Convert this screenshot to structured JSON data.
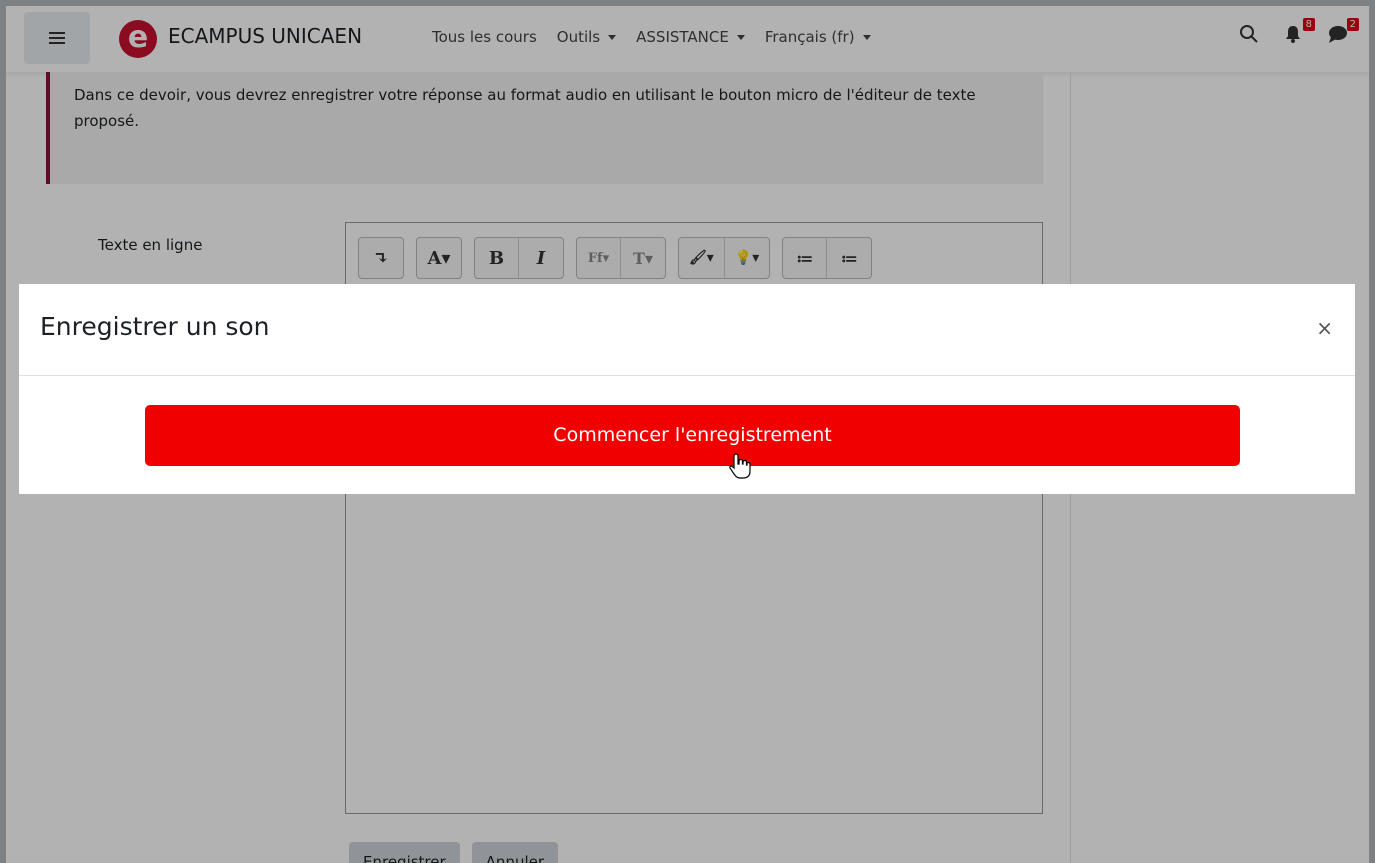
{
  "navbar": {
    "site_name": "ECAMPUS UNICAEN",
    "logo_letter": "e",
    "menu": [
      {
        "label": "Tous les cours",
        "has_caret": false
      },
      {
        "label": "Outils",
        "has_caret": true
      },
      {
        "label": "ASSISTANCE",
        "has_caret": true
      },
      {
        "label": "Français (fr)",
        "has_caret": true
      }
    ],
    "notifications_count": "8",
    "messages_count": "2"
  },
  "assignment": {
    "intro": "Dans ce devoir, vous devrez enregistrer votre réponse au format audio en utilisant le bouton micro de l'éditeur de texte proposé.",
    "online_text_label": "Texte en ligne"
  },
  "editor": {
    "toolbar": [
      [
        "↴"
      ],
      [
        "A▾"
      ],
      [
        "B",
        "I"
      ],
      [
        "Ff▾",
        "T▾"
      ],
      [
        "🖌▾",
        "💡▾"
      ],
      [
        "≔",
        "≔"
      ]
    ]
  },
  "form": {
    "save_label": "Enregistrer",
    "cancel_label": "Annuler"
  },
  "modal": {
    "title": "Enregistrer un son",
    "close_label": "×",
    "record_button_label": "Commencer l'enregistrement"
  },
  "colors": {
    "brand": "#c8102e",
    "record_button": "#f00000",
    "intro_border": "#8a1538"
  }
}
